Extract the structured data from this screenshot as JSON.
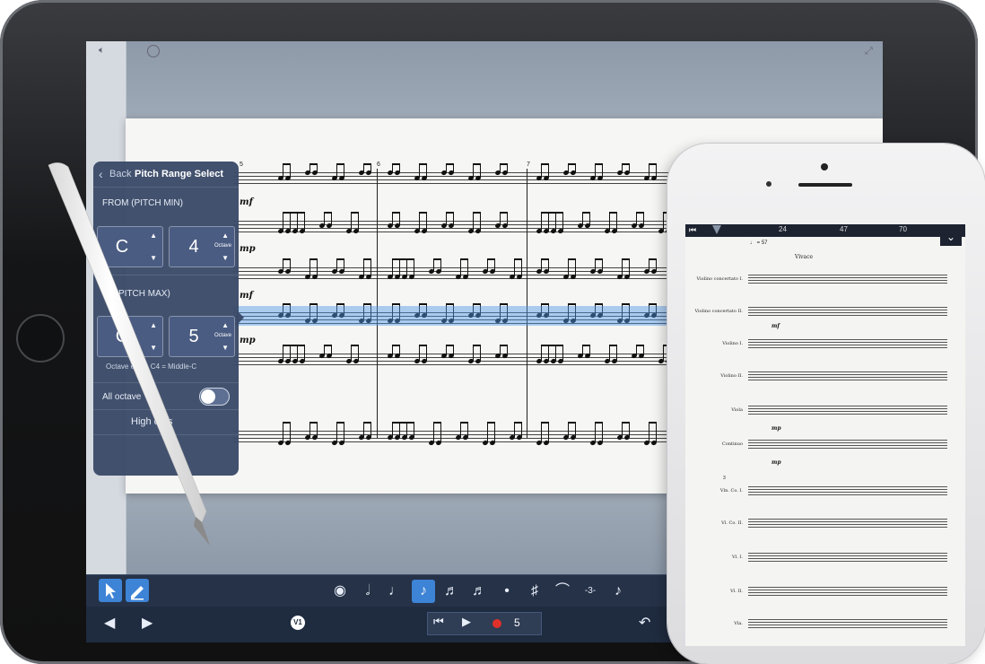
{
  "popover": {
    "back_label": "Back",
    "title": "Pitch Range Select",
    "from_label": "FROM (PITCH MIN)",
    "from_note": "C",
    "from_octave": "4",
    "to_label": "PITCH MAX)",
    "to_note": "C",
    "to_octave": "5",
    "octave_caption": "Octave",
    "octave_note": "Octave  ering: C4 = Middle-C",
    "all_octaves_label": "All octave",
    "highest_notes_label": "High      otes",
    "all_octaves_on": false
  },
  "score": {
    "measure_numbers": [
      "5",
      "6",
      "7"
    ],
    "dynamics": [
      "mf",
      "mp",
      "mf",
      "mp"
    ]
  },
  "toolbar": {
    "voice_label": "V1",
    "measure_field": "5",
    "note_values": [
      "eye",
      "half",
      "quarter",
      "eighth",
      "sixteenth",
      "thirty-second",
      "dot",
      "sharp",
      "tie",
      "triplet",
      "grace"
    ],
    "selected_note_value": "eighth"
  },
  "phone": {
    "timeline_marks": [
      "24",
      "47",
      "70"
    ],
    "tempo": "♩ = 57",
    "tempo_marking": "Vivace",
    "system1_instruments": [
      "Violino concertato I.",
      "Violino concertato II.",
      "Violino I.",
      "Violino II.",
      "Viola",
      "Continuo"
    ],
    "system2_instruments": [
      "Vln. Co. I.",
      "Vl. Co. II.",
      "Vl. I.",
      "Vl. II.",
      "Vla."
    ],
    "system2_number": "3",
    "dynamics": [
      "mf",
      "mp",
      "mp"
    ]
  },
  "colors": {
    "accent": "#3d83d6",
    "popover_bg": "#3a4a68",
    "highlight": "#5096e6",
    "record": "#e0302a"
  }
}
